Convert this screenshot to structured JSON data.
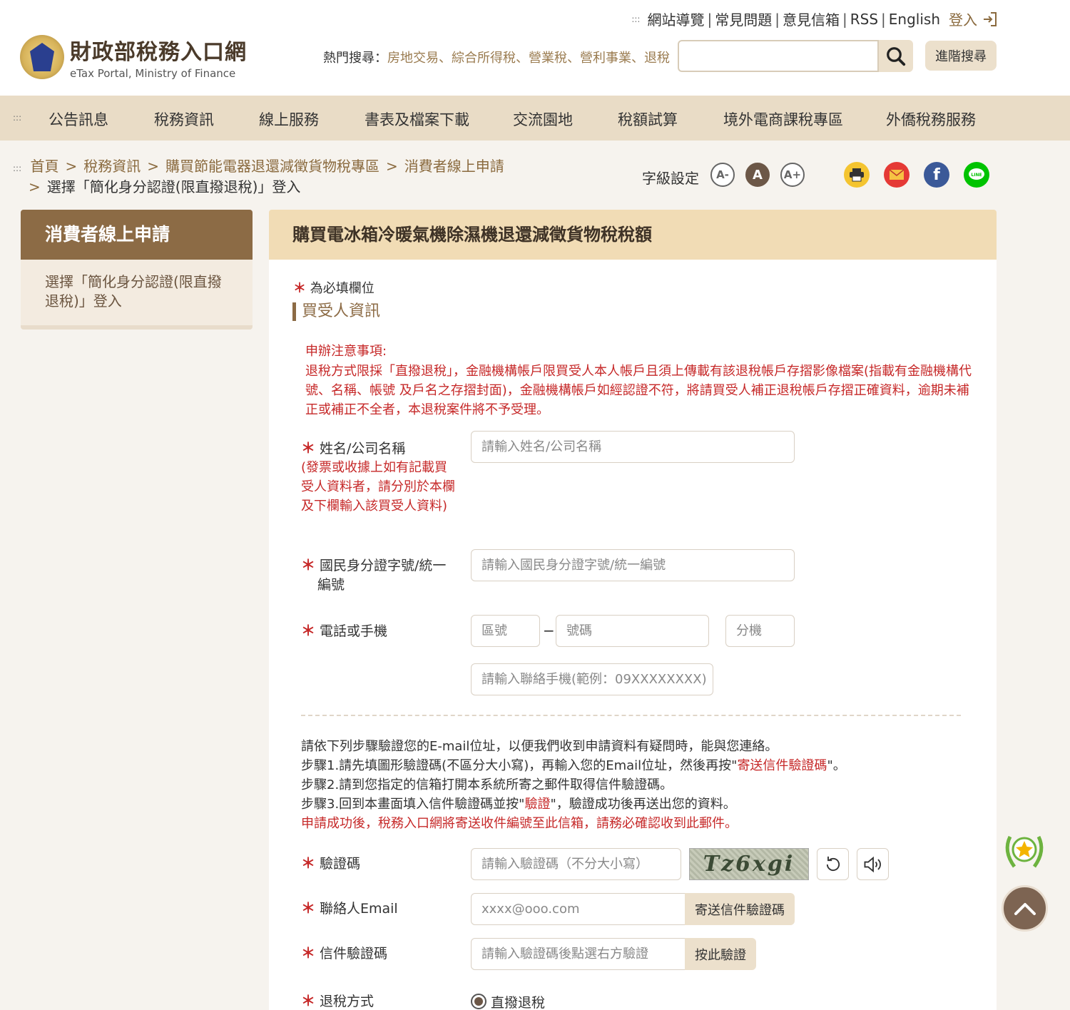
{
  "header": {
    "top_links": [
      "網站導覽",
      "常見問題",
      "意見信箱",
      "RSS",
      "English"
    ],
    "login_label": "登入",
    "logo_cn": "財政部稅務入口網",
    "logo_en": "eTax Portal, Ministry of Finance",
    "hot_label": "熱門搜尋：",
    "hot_keywords": [
      "房地交易",
      "綜合所得稅",
      "營業稅",
      "營利事業",
      "退稅"
    ],
    "search_value": "",
    "advanced_search": "進階搜尋"
  },
  "nav": {
    "dots": ":::",
    "items": [
      "公告訊息",
      "稅務資訊",
      "線上服務",
      "書表及檔案下載",
      "交流園地",
      "稅額試算",
      "境外電商課稅專區",
      "外僑稅務服務"
    ]
  },
  "breadcrumb": {
    "dots": ":::",
    "items": [
      "首頁",
      "稅務資訊",
      "購買節能電器退還減徵貨物稅專區",
      "消費者線上申請"
    ],
    "current": "選擇「簡化身分認證(限直撥退稅)」登入"
  },
  "tools": {
    "font_setting_label": "字級設定",
    "font_small": "A-",
    "font_medium": "A",
    "font_large": "A+"
  },
  "sidebar": {
    "title": "消費者線上申請",
    "item": "選擇「簡化身分認證(限直撥退稅)」登入"
  },
  "main": {
    "title": "購買電冰箱冷暖氣機除濕機退還減徵貨物稅稅額",
    "required_note": "為必填欄位",
    "section_title": "買受人資訊",
    "notice_title": "申辦注意事項:",
    "notice_body": "退稅方式限採「直撥退稅」，金融機構帳戶限買受人本人帳戶且須上傳載有該退稅帳戶存摺影像檔案(指載有金融機構代號、名稱、帳號 及戶名之存摺封面)，金融機構帳戶如經認證不符，將請買受人補正退稅帳戶存摺正確資料，逾期未補正或補正不全者，本退稅案件將不予受理。",
    "star": "＊",
    "fields": {
      "name_label": "姓名/公司名稱",
      "name_hint": "(發票或收據上如有記載買受人資料者，請分別於本欄及下欄輸入該買受人資料)",
      "name_placeholder": "請輸入姓名/公司名稱",
      "id_label": "國民身分證字號/統一編號",
      "id_placeholder": "請輸入國民身分證字號/統一編號",
      "phone_label": "電話或手機",
      "area_placeholder": "區號",
      "dash": "−",
      "number_placeholder": "號碼",
      "ext_placeholder": "分機",
      "mobile_placeholder": "請輸入聯絡手機(範例：09XXXXXXXX)",
      "captcha_label": "驗證碼",
      "captcha_placeholder": "請輸入驗證碼（不分大小寫）",
      "captcha_text": "Tz6xgi",
      "email_label": "聯絡人Email",
      "email_placeholder": "xxxx@ooo.com",
      "send_code_button": "寄送信件驗證碼",
      "mail_code_label": "信件驗證碼",
      "mail_code_placeholder": "請輸入驗證碼後點選右方驗證",
      "verify_button": "按此驗證",
      "refund_label": "退稅方式",
      "refund_option": "直撥退稅"
    },
    "steps": {
      "line1": "請依下列步驟驗證您的E-mail位址，以便我們收到申請資料有疑問時，能與您連絡。",
      "line2_a": "步驟1.請先填圖形驗證碼(不區分大小寫)，再輸入您的Email位址，然後再按\"",
      "line2_red": "寄送信件驗證碼",
      "line2_b": "\"。",
      "line3": "步驟2.請到您指定的信箱打開本系統所寄之郵件取得信件驗證碼。",
      "line4_a": "步驟3.回到本畫面填入信件驗證碼並按\"",
      "line4_red": "驗證",
      "line4_b": "\"，驗證成功後再送出您的資料。",
      "line5": "申請成功後，稅務入口網將寄送收件編號至此信箱，請務必確認收到此郵件。"
    }
  },
  "colors": {
    "accent": "#8c6b45",
    "nav_bg": "#e9dcc6",
    "panel_head": "#f1dcb5",
    "warning": "#c62828"
  }
}
